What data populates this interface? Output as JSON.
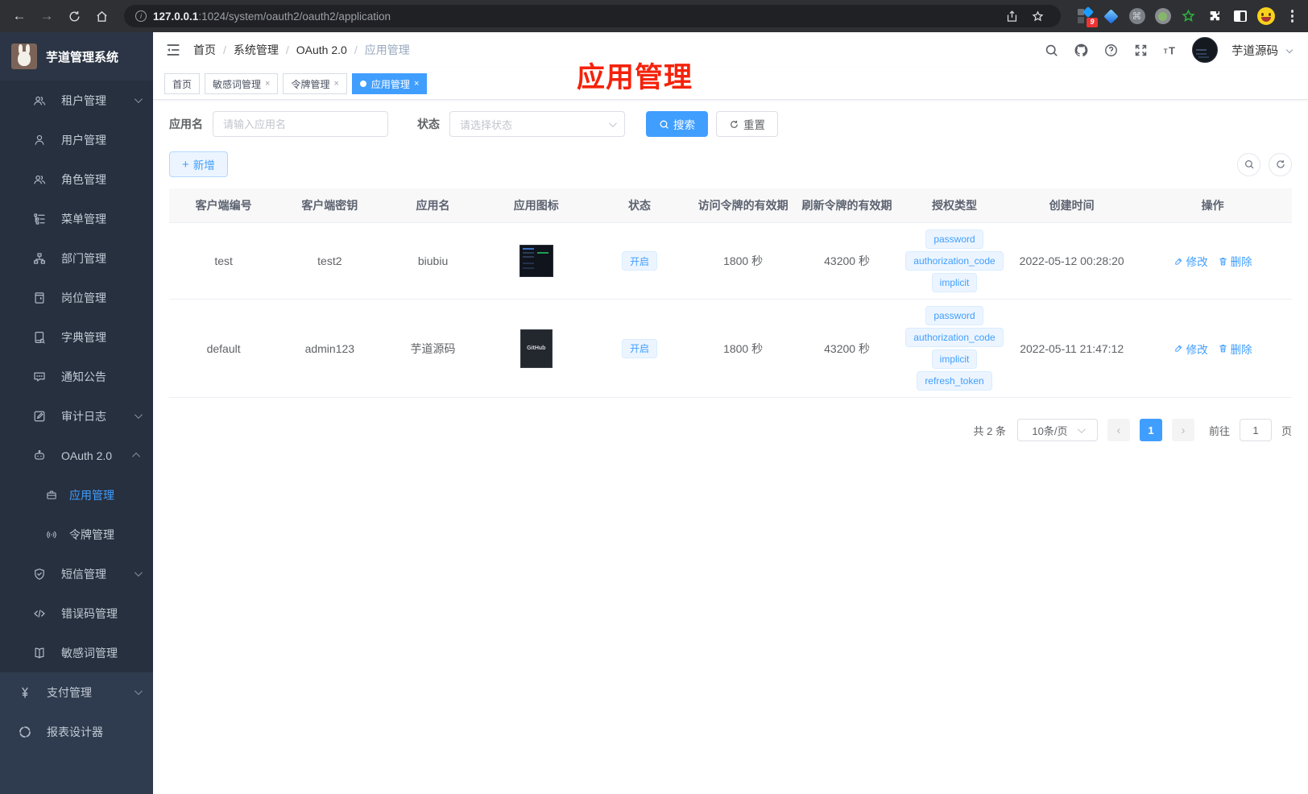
{
  "colors": {
    "accent": "#409eff",
    "annotation_red": "#f5220b",
    "tag_bg": "#ecf5ff",
    "sidebar_bg": "#27303f"
  },
  "browser": {
    "url_host": "127.0.0.1",
    "url_rest": ":1024/system/oauth2/oauth2/application",
    "ext_badge": "9"
  },
  "sidebar": {
    "title": "芋道管理系统",
    "items": [
      {
        "label": "租户管理",
        "icon": "users",
        "chevron": "down"
      },
      {
        "label": "用户管理",
        "icon": "user"
      },
      {
        "label": "角色管理",
        "icon": "users"
      },
      {
        "label": "菜单管理",
        "icon": "tree"
      },
      {
        "label": "部门管理",
        "icon": "org"
      },
      {
        "label": "岗位管理",
        "icon": "badge"
      },
      {
        "label": "字典管理",
        "icon": "dict"
      },
      {
        "label": "通知公告",
        "icon": "comment"
      },
      {
        "label": "审计日志",
        "icon": "editlog",
        "chevron": "down"
      },
      {
        "label": "OAuth 2.0",
        "icon": "robot",
        "chevron": "up",
        "children": [
          {
            "label": "应用管理",
            "icon": "briefcase",
            "active": true
          },
          {
            "label": "令牌管理",
            "icon": "signal"
          }
        ]
      },
      {
        "label": "短信管理",
        "icon": "shield",
        "chevron": "down"
      },
      {
        "label": "错误码管理",
        "icon": "code"
      },
      {
        "label": "敏感词管理",
        "icon": "openbook"
      },
      {
        "label": "支付管理",
        "icon": "yen",
        "chevron": "down",
        "section": "light"
      },
      {
        "label": "报表设计器",
        "icon": "pie",
        "section": "light"
      }
    ]
  },
  "navbar": {
    "breadcrumb": [
      "首页",
      "系统管理",
      "OAuth 2.0",
      "应用管理"
    ],
    "username": "芋道源码"
  },
  "annotation": {
    "text": "应用管理"
  },
  "tabs": [
    {
      "label": "首页",
      "closable": false,
      "active": false
    },
    {
      "label": "敏感词管理",
      "closable": true,
      "active": false
    },
    {
      "label": "令牌管理",
      "closable": true,
      "active": false
    },
    {
      "label": "应用管理",
      "closable": true,
      "active": true
    }
  ],
  "filter": {
    "name_label": "应用名",
    "name_placeholder": "请输入应用名",
    "status_label": "状态",
    "status_placeholder": "请选择状态",
    "search_label": "搜索",
    "reset_label": "重置"
  },
  "toolbar": {
    "add_label": "新增"
  },
  "table": {
    "columns": [
      "客户端编号",
      "客户端密钥",
      "应用名",
      "应用图标",
      "状态",
      "访问令牌的有效期",
      "刷新令牌的有效期",
      "授权类型",
      "创建时间",
      "操作"
    ],
    "action_edit": "修改",
    "action_delete": "删除",
    "rows": [
      {
        "client_id": "test",
        "secret": "test2",
        "name": "biubiu",
        "icon_type": "dashboard",
        "status": "开启",
        "access_ttl": "1800 秒",
        "refresh_ttl": "43200 秒",
        "grants": [
          "password",
          "authorization_code",
          "implicit"
        ],
        "created": "2022-05-12 00:28:20"
      },
      {
        "client_id": "default",
        "secret": "admin123",
        "name": "芋道源码",
        "icon_type": "github",
        "icon_text": "GitHub",
        "status": "开启",
        "access_ttl": "1800 秒",
        "refresh_ttl": "43200 秒",
        "grants": [
          "password",
          "authorization_code",
          "implicit",
          "refresh_token"
        ],
        "created": "2022-05-11 21:47:12"
      }
    ]
  },
  "pagination": {
    "total": "共 2 条",
    "page_size": "10条/页",
    "current_page": "1",
    "goto_label": "前往",
    "goto_value": "1",
    "unit_label": "页"
  }
}
